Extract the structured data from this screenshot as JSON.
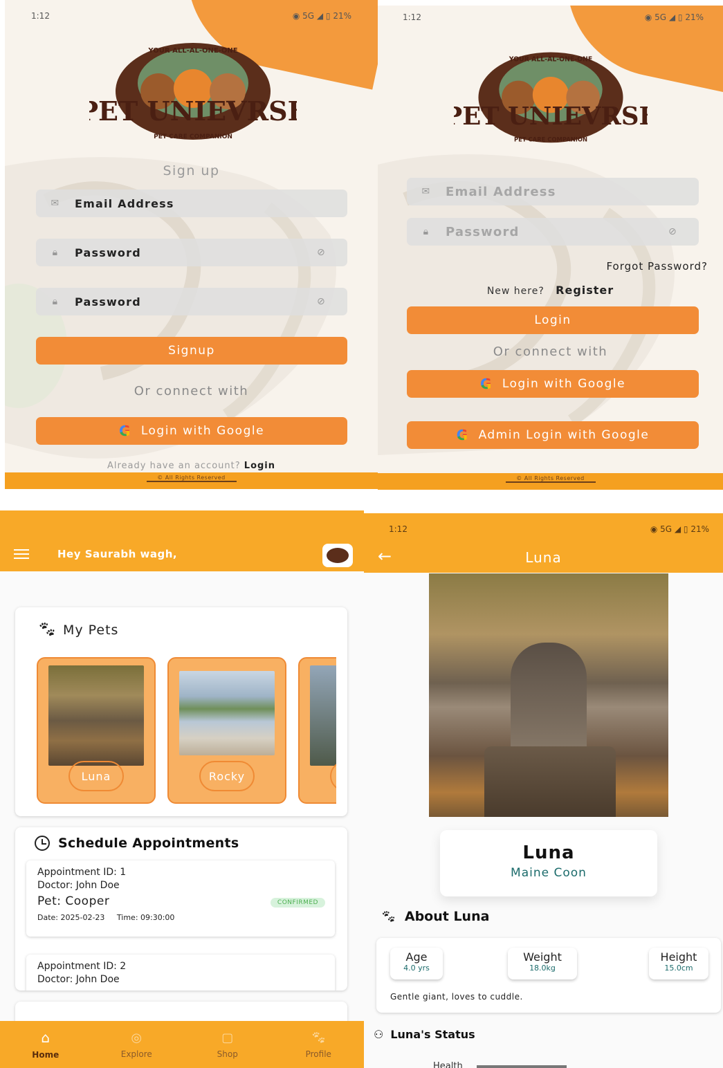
{
  "status": {
    "time": "1:12",
    "icons_left": "Wₐ ♡",
    "network": "5G",
    "battery": "21%"
  },
  "logo": {
    "top_arc": "YOUR ALL-AL-ONE-ONE",
    "name": "PET UNIEVRSE",
    "bottom_arc": "PET CARE COMPANION"
  },
  "signup": {
    "title": "Sign up",
    "email_label": "Email Address",
    "password_label": "Password",
    "confirm_password_label": "Password",
    "signup_button": "Signup",
    "or_connect": "Or connect with",
    "google_button": "Login with Google",
    "already_text": "Already have an account?",
    "login_link": "Login",
    "copyright": "© All Rights Reserved"
  },
  "login": {
    "email_placeholder": "Email Address",
    "password_placeholder": "Password",
    "forgot": "Forgot Password?",
    "new_here": "New here?",
    "register": "Register",
    "login_button": "Login",
    "or_connect": "Or connect with",
    "google_button": "Login with Google",
    "admin_google_button": "Admin Login with Google",
    "copyright": "© All Rights Reserved"
  },
  "home": {
    "greeting": "Hey Saurabh wagh,",
    "my_pets_title": "My Pets",
    "pets": [
      {
        "name": "Luna"
      },
      {
        "name": "Rocky"
      },
      {
        "name": "C"
      }
    ],
    "schedule_title": "Schedule Appointments",
    "appointments": [
      {
        "id": "Appointment ID: 1",
        "doctor": "Doctor: John Doe",
        "pet": "Pet: Cooper",
        "status": "CONFIRMED",
        "date": "Date: 2025-02-23",
        "time": "Time: 09:30:00"
      },
      {
        "id": "Appointment ID: 2",
        "doctor": "Doctor: John Doe"
      }
    ],
    "nav": [
      {
        "label": "Home"
      },
      {
        "label": "Explore"
      },
      {
        "label": "Shop"
      },
      {
        "label": "Profile"
      }
    ],
    "colors": {
      "accent": "#f8a928",
      "card": "#f8b062",
      "confirmed_bg": "#d7f2dc",
      "confirmed_fg": "#4caf50"
    }
  },
  "detail": {
    "title": "Luna",
    "name": "Luna",
    "breed": "Maine Coon",
    "about_title": "About Luna",
    "stats": [
      {
        "label": "Age",
        "value": "4.0 yrs"
      },
      {
        "label": "Weight",
        "value": "18.0kg"
      },
      {
        "label": "Height",
        "value": "15.0cm"
      }
    ],
    "description": "Gentle giant, loves to cuddle.",
    "status_title": "Luna's Status",
    "status_partial": "Health"
  }
}
